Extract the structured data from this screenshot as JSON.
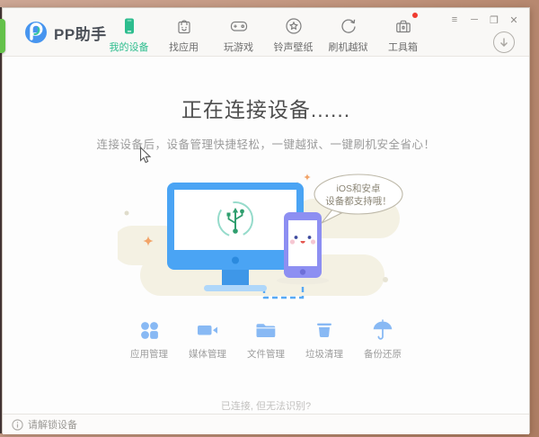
{
  "app": {
    "name": "PP助手"
  },
  "window_controls": {
    "menu": "≡",
    "minimize": "─",
    "maximize": "❐",
    "close": "✕"
  },
  "nav": {
    "tabs": [
      {
        "label": "我的设备",
        "icon": "device-phone-icon",
        "active": true
      },
      {
        "label": "找应用",
        "icon": "app-bag-icon",
        "active": false
      },
      {
        "label": "玩游戏",
        "icon": "gamepad-icon",
        "active": false
      },
      {
        "label": "铃声壁纸",
        "icon": "star-circle-icon",
        "active": false
      },
      {
        "label": "刷机越狱",
        "icon": "refresh-icon",
        "active": false
      },
      {
        "label": "工具箱",
        "icon": "toolbox-icon",
        "active": false,
        "badge": true
      }
    ]
  },
  "main": {
    "title": "正在连接设备......",
    "subtitle": "连接设备后，设备管理快捷轻松，一键越狱、一键刷机安全省心！",
    "bubble": {
      "line1": "iOS和安卓",
      "line2": "设备都支持哦！"
    },
    "features": [
      {
        "label": "应用管理",
        "icon": "apps-grid-icon"
      },
      {
        "label": "媒体管理",
        "icon": "video-camera-icon"
      },
      {
        "label": "文件管理",
        "icon": "folder-icon"
      },
      {
        "label": "垃圾清理",
        "icon": "trash-icon"
      },
      {
        "label": "备份还原",
        "icon": "umbrella-icon"
      }
    ],
    "help_link": "已连接, 但无法识别?"
  },
  "statusbar": {
    "text": "请解锁设备"
  },
  "colors": {
    "accent_green": "#2dbd8e",
    "monitor_blue": "#4aa4f4",
    "phone_purple": "#8d8ff2",
    "feature_blue": "#88b9f4",
    "badge_red": "#f03b30",
    "usb_green": "#2f9e6e",
    "blob_beige": "#f4f1e3"
  }
}
